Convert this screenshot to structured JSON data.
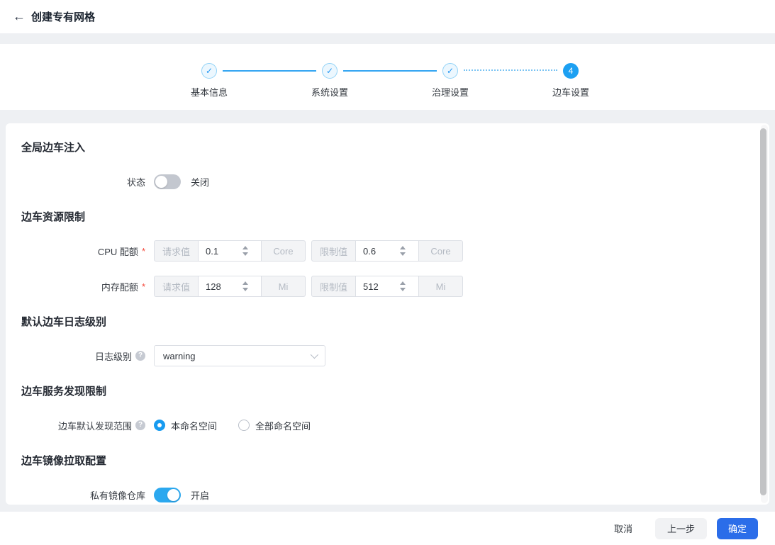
{
  "colors": {
    "primary_button": "#2B6DE9",
    "stepper_blue": "#1DA0F2",
    "toggle_on": "#2BA8EF",
    "toggle_off": "#C3C7CF",
    "radio_selected": "#189BF0",
    "required_asterisk": "#F5483B"
  },
  "icons": {
    "back": "←",
    "check": "✓",
    "help": "?"
  },
  "required_mark": "*",
  "header": {
    "title": "创建专有网格"
  },
  "stepper": {
    "steps": [
      {
        "label": "基本信息",
        "state": "done"
      },
      {
        "label": "系统设置",
        "state": "done"
      },
      {
        "label": "治理设置",
        "state": "done"
      },
      {
        "label": "边车设置",
        "state": "active",
        "number": "4"
      }
    ]
  },
  "form": {
    "global_injection": {
      "title": "全局边车注入",
      "status_label": "状态",
      "status_value": "关闭",
      "status_on": false
    },
    "resources": {
      "title": "边车资源限制",
      "cpu": {
        "label": "CPU 配额",
        "request_prefix": "请求值",
        "request_value": "0.1",
        "request_unit": "Core",
        "limit_prefix": "限制值",
        "limit_value": "0.6",
        "limit_unit": "Core"
      },
      "memory": {
        "label": "内存配额",
        "request_prefix": "请求值",
        "request_value": "128",
        "request_unit": "Mi",
        "limit_prefix": "限制值",
        "limit_value": "512",
        "limit_unit": "Mi"
      }
    },
    "log": {
      "title": "默认边车日志级别",
      "level_label": "日志级别",
      "level_value": "warning"
    },
    "discovery": {
      "title": "边车服务发现限制",
      "scope_label": "边车默认发现范围",
      "options": [
        {
          "label": "本命名空间",
          "selected": true
        },
        {
          "label": "全部命名空间",
          "selected": false
        }
      ]
    },
    "image_pull": {
      "title": "边车镜像拉取配置",
      "registry_label": "私有镜像仓库",
      "registry_value": "开启",
      "registry_on": true
    }
  },
  "footer": {
    "cancel_label": "取消",
    "prev_label": "上一步",
    "confirm_label": "确定"
  }
}
